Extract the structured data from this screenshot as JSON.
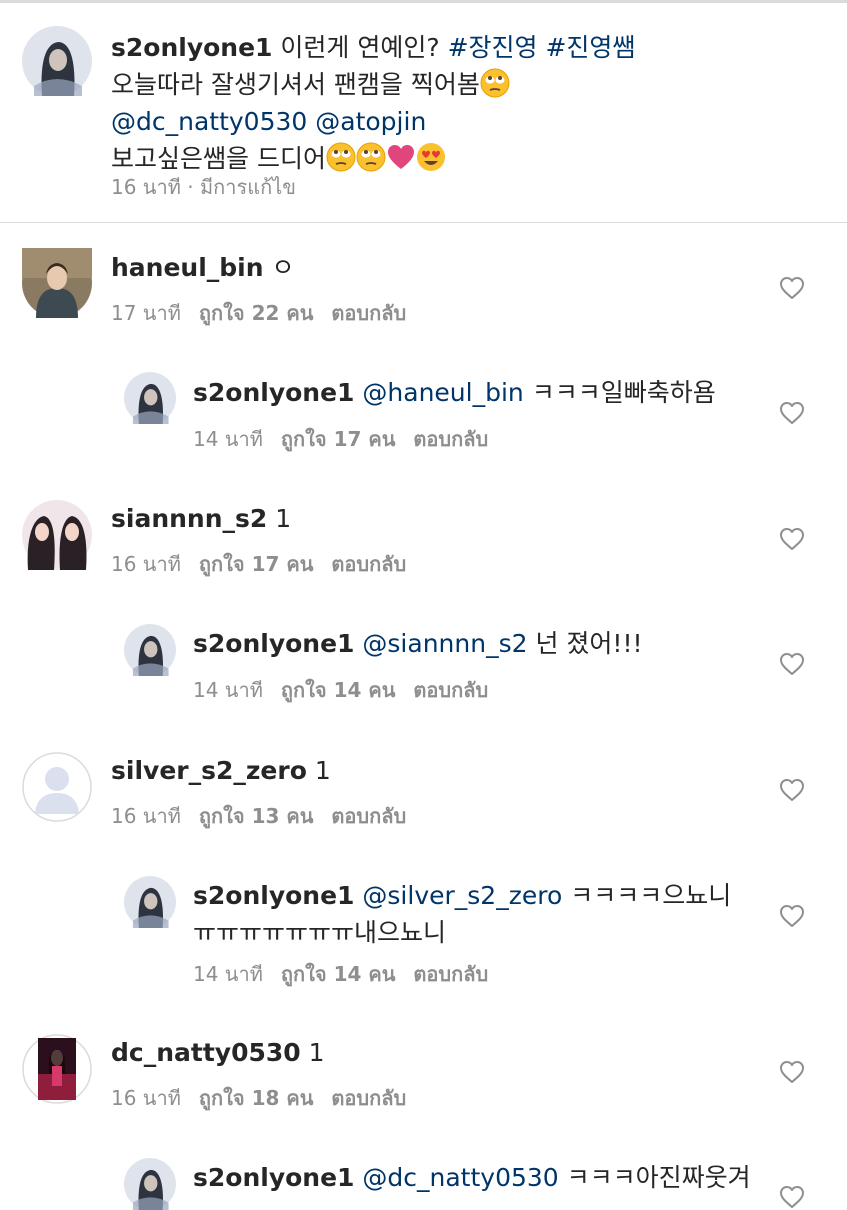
{
  "caption": {
    "username": "s2onlyone1",
    "line1_text": "이런게 연예인?",
    "hashtag1": "#장진영",
    "hashtag2": "#진영쌤",
    "line2_text": "오늘따라 잘생기셔서 팬캠을 찍어봄",
    "mention1": "@dc_natty0530",
    "mention2": "@atopjin",
    "line4_text": "보고싶은쌤을 드디어",
    "time": "16 นาที",
    "edited": "มีการแก้ไข",
    "separator": "·"
  },
  "comments": [
    {
      "username": "haneul_bin",
      "text": "ㅇ",
      "time": "17 นาที",
      "likes": "ถูกใจ 22 คน",
      "reply_label": "ตอบกลับ",
      "avatar_icon": "user-photo-avatar-icon"
    },
    {
      "username": "s2onlyone1",
      "mention": "@haneul_bin",
      "text": "ㅋㅋㅋ일빠축하욤",
      "time": "14 นาที",
      "likes": "ถูกใจ 17 คน",
      "reply_label": "ตอบกลับ",
      "avatar_icon": "user-photo-avatar-icon"
    },
    {
      "username": "siannnn_s2",
      "text": "1",
      "time": "16 นาที",
      "likes": "ถูกใจ 17 คน",
      "reply_label": "ตอบกลับ",
      "avatar_icon": "user-photo-avatar-icon"
    },
    {
      "username": "s2onlyone1",
      "mention": "@siannnn_s2",
      "text": "넌 졌어!!!",
      "time": "14 นาที",
      "likes": "ถูกใจ 14 คน",
      "reply_label": "ตอบกลับ",
      "avatar_icon": "user-photo-avatar-icon"
    },
    {
      "username": "silver_s2_zero",
      "text": "1",
      "time": "16 นาที",
      "likes": "ถูกใจ 13 คน",
      "reply_label": "ตอบกลับ",
      "avatar_icon": "default-avatar-icon"
    },
    {
      "username": "s2onlyone1",
      "mention": "@silver_s2_zero",
      "text": "ㅋㅋㅋㅋ으뇨니",
      "text2": "ㅠㅠㅠㅠㅠㅠㅠ내으뇨니",
      "time": "14 นาที",
      "likes": "ถูกใจ 14 คน",
      "reply_label": "ตอบกลับ",
      "avatar_icon": "user-photo-avatar-icon"
    },
    {
      "username": "dc_natty0530",
      "text": "1",
      "time": "16 นาที",
      "likes": "ถูกใจ 18 คน",
      "reply_label": "ตอบกลับ",
      "avatar_icon": "user-photo-avatar-icon"
    },
    {
      "username": "s2onlyone1",
      "mention": "@dc_natty0530",
      "text": "ㅋㅋㅋ아진짜웃겨",
      "avatar_icon": "user-photo-avatar-icon"
    }
  ],
  "colors": {
    "text": "#262626",
    "link": "#003569",
    "meta": "#8e8e8e",
    "divider": "#dbdbdb",
    "heart_emoji": "#e0457b"
  },
  "icons": {
    "like": "heart-outline-icon",
    "emoji_rolling_eyes": "face-with-rolling-eyes-emoji",
    "emoji_heart": "pink-heart-emoji",
    "emoji_heart_eyes": "smiling-face-with-heart-eyes-emoji"
  }
}
